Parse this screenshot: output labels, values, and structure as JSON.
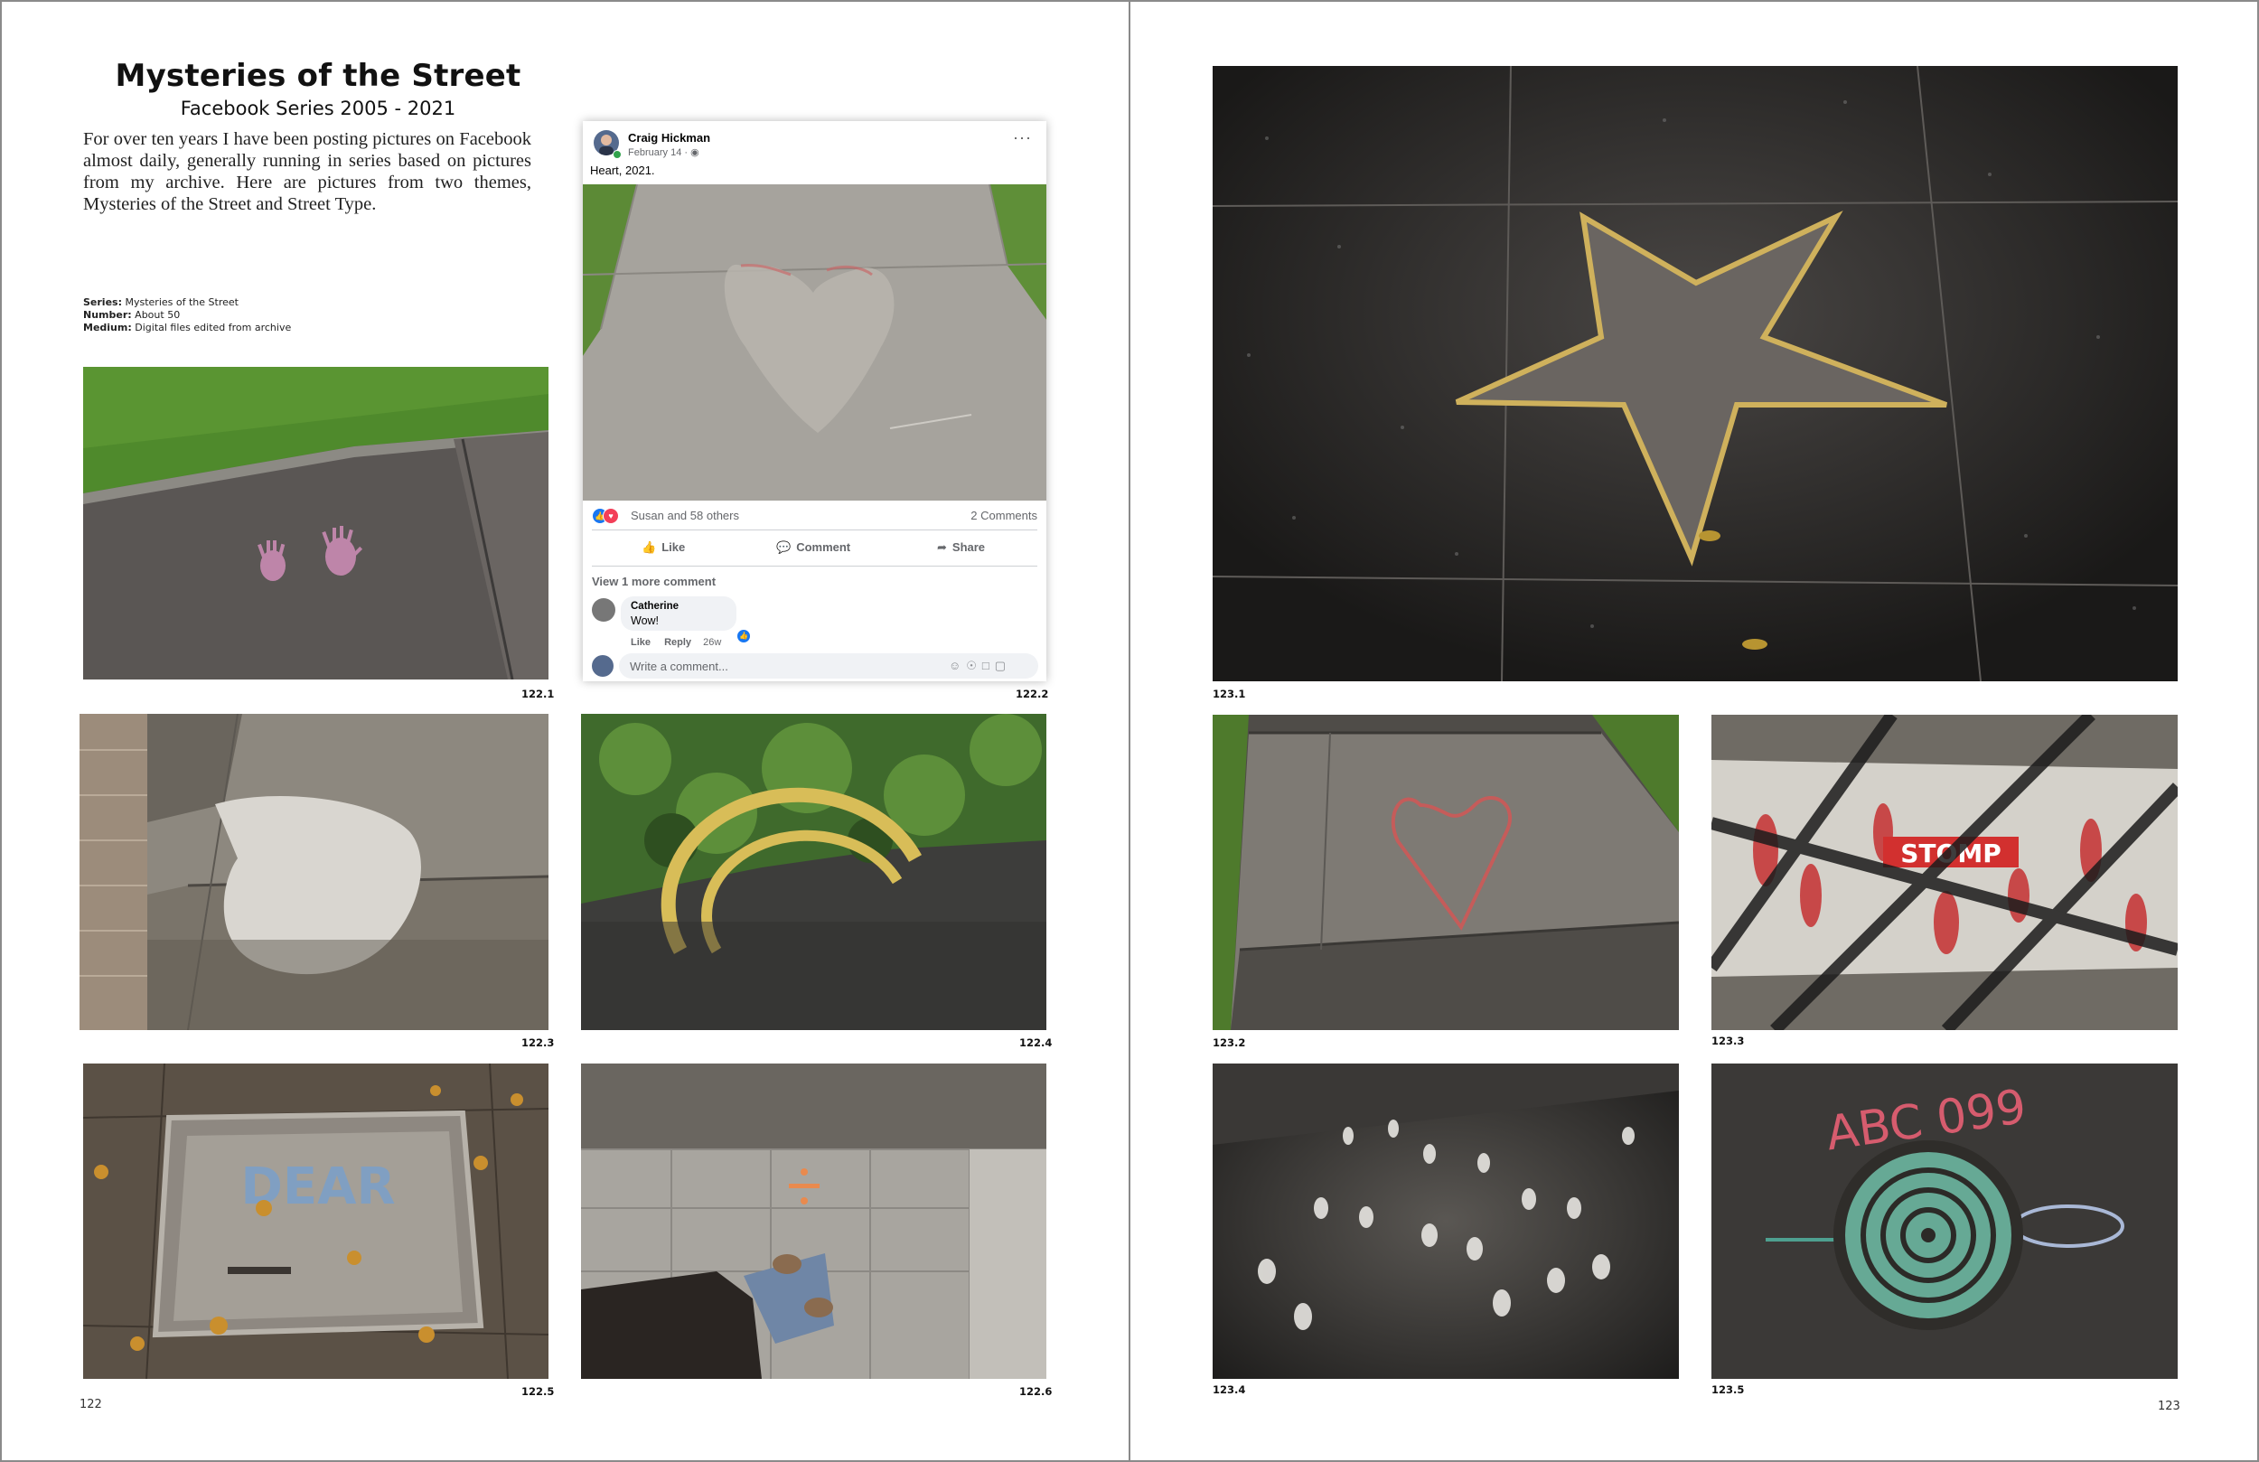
{
  "left_page": {
    "title": "Mysteries of the Street",
    "subtitle": "Facebook Series 2005 - 2021",
    "intro": "For over ten years I have been posting pictures on Facebook almost daily, generally running in series based on pictures from my archive. Here are pictures from two themes, Mysteries of the Street and Street Type.",
    "meta": {
      "series_label": "Series:",
      "series_value": "Mysteries of the Street",
      "number_label": "Number:",
      "number_value": "About 50",
      "medium_label": "Medium:",
      "medium_value": "Digital files edited from archive"
    },
    "captions": [
      "122.1",
      "122.2",
      "122.3",
      "122.4",
      "122.5",
      "122.6"
    ],
    "page_number": "122"
  },
  "right_page": {
    "captions": [
      "123.1",
      "123.2",
      "123.3",
      "123.4",
      "123.5"
    ],
    "page_number": "123"
  },
  "facebook_post": {
    "author": "Craig Hickman",
    "date": "February 14 · ",
    "globe_icon": "globe-icon",
    "more_label": "···",
    "text": "Heart, 2021.",
    "reactions_text": "Susan and 58 others",
    "comments_count": "2 Comments",
    "actions": {
      "like": "Like",
      "comment": "Comment",
      "share": "Share"
    },
    "view_more": "View 1 more comment",
    "comment": {
      "author": "Catherine",
      "text": "Wow!",
      "like": "Like",
      "reply": "Reply",
      "age": "26w"
    },
    "write_placeholder": "Write a comment..."
  },
  "photos": {
    "p122_4_sign": "STOMP",
    "p123_5_graffiti": "ABC 099",
    "p122_5_graffiti": "DEAR"
  },
  "colors": {
    "page_border": "#8a8a8a",
    "fb_blue": "#1877f2",
    "fb_grey": "#65676b"
  }
}
